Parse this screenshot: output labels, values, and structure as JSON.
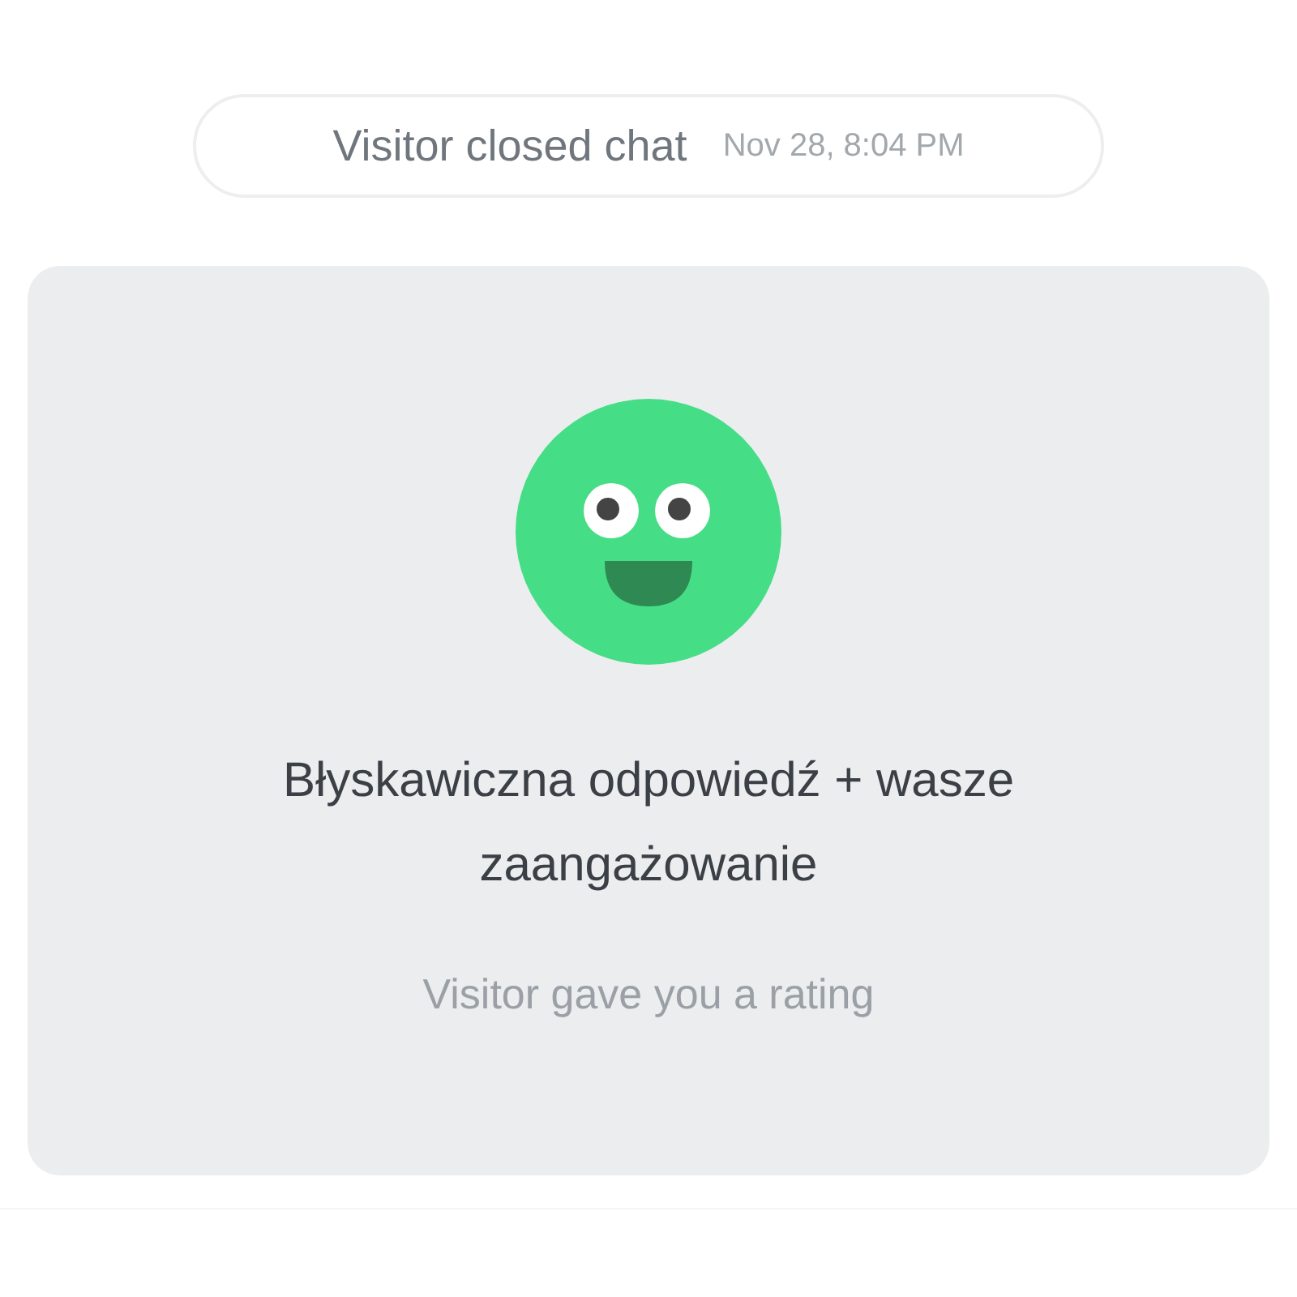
{
  "event": {
    "text": "Visitor closed chat",
    "time": "Nov 28, 8:04 PM"
  },
  "rating": {
    "kind": "good",
    "title": "Błyskawiczna odpowiedź + wasze zaangażowanie",
    "caption": "Visitor gave you a rating"
  }
}
